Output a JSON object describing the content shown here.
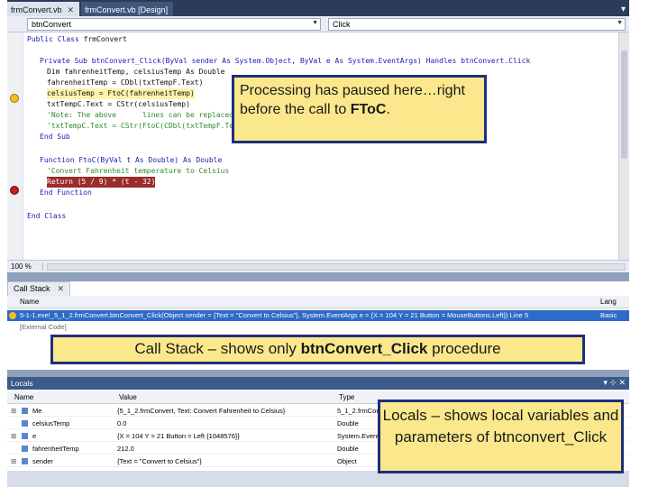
{
  "tabs": [
    {
      "label": "frmConvert.vb",
      "active": true
    },
    {
      "label": "frmConvert.vb [Design]",
      "active": false
    }
  ],
  "combos": {
    "left": "btnConvert",
    "right": "Click"
  },
  "code": {
    "line1": "Public Class frmConvert",
    "line2a": "Private Sub btnConvert_Click(ByVal sender As System.Object, ByVal e As System.EventArgs) Handles btnConvert.Click",
    "line3": "Dim fahrenheitTemp, celsiusTemp As Double",
    "line4": "fahrenheitTemp = CDbl(txtTempF.Text)",
    "line5": "celsiusTemp = FtoC(fahrenheitTemp)",
    "line6": "txtTempC.Text = CStr(celsiusTemp)",
    "line7": "'Note: The above      lines can be replaced by the line",
    "line8": "'txtTempC.Text = CStr(FtoC(CDbl(txtTempF.Te",
    "line9": "End Sub",
    "line10": "Function FtoC(ByVal t As Double) As Double",
    "line11": "'Convert Fahrenheit temperature to Celsius",
    "line12": "Return (5 / 9) * (t - 32)",
    "line13": "End Function",
    "line14": "End Class"
  },
  "zoom": "100 %",
  "call_stack": {
    "tab_label": "Call Stack",
    "col_name": "Name",
    "col_lang": "Lang",
    "row1": "5-1-1.exe!_5_1_2.frmConvert.btnConvert_Click(Object sender = {Text = \"Convert to Celsius\"}, System.EventArgs e = {X = 104 Y = 21 Button = MouseButtons.Left}) Line 5",
    "row1_lang": "Basic",
    "row2": "[External Code]"
  },
  "locals": {
    "title": "Locals",
    "col_name": "Name",
    "col_value": "Value",
    "col_type": "Type",
    "rows": [
      {
        "expand": "⊞",
        "name": "Me",
        "value": "{5_1_2.frmConvert, Text: Convert Fahrenheit to Celsius}",
        "type": "5_1_2.frmConvert"
      },
      {
        "expand": "",
        "name": "celsiusTemp",
        "value": "0.0",
        "type": "Double"
      },
      {
        "expand": "⊞",
        "name": "e",
        "value": "{X = 104 Y = 21 Button = Left {1048576}}",
        "type": "System.EventArgs"
      },
      {
        "expand": "",
        "name": "fahrenheitTemp",
        "value": "212.0",
        "type": "Double"
      },
      {
        "expand": "⊞",
        "name": "sender",
        "value": "{Text = \"Convert to Celsius\"}",
        "type": "Object"
      }
    ]
  },
  "callouts": {
    "paused_1": "Processing has paused here…right before the call to ",
    "paused_bold": "FToC",
    "paused_2": ".",
    "cs_1": "Call Stack – shows only ",
    "cs_bold": "btnConvert_Click",
    "cs_2": " procedure",
    "locals": "Locals – shows local variables and parameters of btnconvert_Click"
  }
}
